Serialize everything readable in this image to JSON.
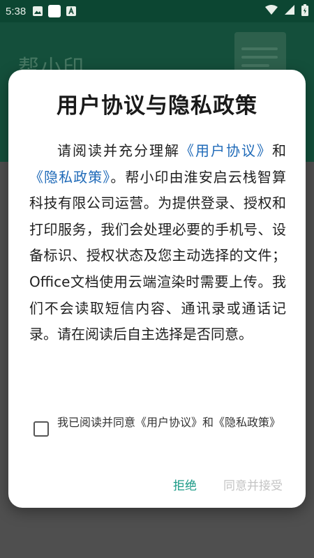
{
  "status_bar": {
    "time": "5:38",
    "icons": [
      "image-icon",
      "square-icon",
      "a-badge-icon"
    ],
    "right_icons": [
      "wifi-icon",
      "signal-icon",
      "battery-icon"
    ]
  },
  "background": {
    "app_name": "帮小印"
  },
  "dialog": {
    "title": "用户协议与隐私政策",
    "body": {
      "p1": "请阅读并充分理解",
      "link_user_agreement": "《用户协议》",
      "p2": "和",
      "link_privacy_policy": "《隐私政策》",
      "p3": "。帮小印由淮安启云栈智算科技有限公司运营。为提供登录、授权和打印服务，我们会处理必要的手机号、设备标识、授权状态及您主动选择的文件；Office文档使用云端渲染时需要上传。我们不会读取短信内容、通讯录或通话记录。请在阅读后自主选择是否同意。"
    },
    "consent_label": "我已阅读并同意《用户协议》和《隐私政策》",
    "consent_checked": false,
    "reject_label": "拒绝",
    "accept_label": "同意并接受",
    "colors": {
      "link": "#1f6ab8",
      "reject": "#1a9a86",
      "accept_disabled": "#c4c4c4",
      "header": "#1b6a4f"
    }
  }
}
